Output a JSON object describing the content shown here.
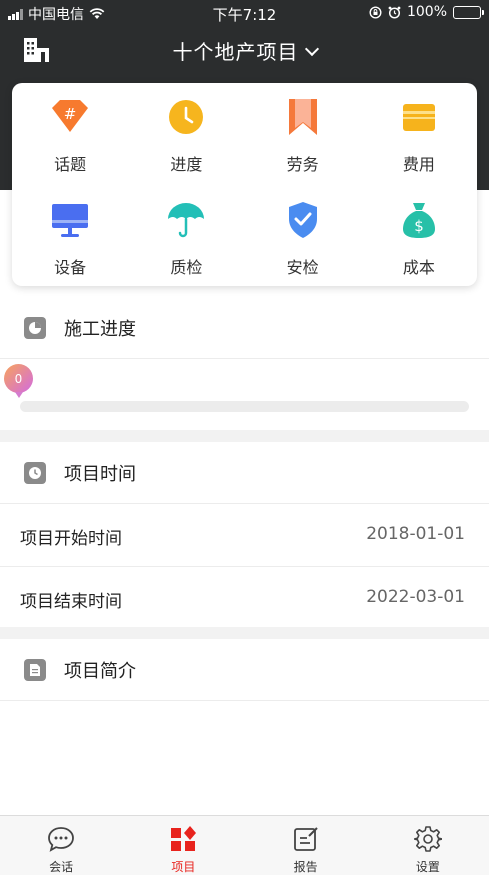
{
  "status_bar": {
    "carrier": "中国电信",
    "time": "下午7:12",
    "battery": "100%",
    "battery_level": 1.0
  },
  "nav": {
    "title": "十个地产项目",
    "left_icon": "building-icon",
    "title_icon": "chevron-down-icon"
  },
  "menu": {
    "items": [
      {
        "label": "话题",
        "icon": "hashtag-diamond-icon",
        "color": "#f77a2e"
      },
      {
        "label": "进度",
        "icon": "clock-icon",
        "color": "#f6b51e"
      },
      {
        "label": "劳务",
        "icon": "bookmark-icon",
        "color": "#f5793b"
      },
      {
        "label": "费用",
        "icon": "wallet-icon",
        "color": "#f6b31c"
      },
      {
        "label": "设备",
        "icon": "monitor-icon",
        "color": "#4a6ef0"
      },
      {
        "label": "质检",
        "icon": "umbrella-icon",
        "color": "#23bfb7"
      },
      {
        "label": "安检",
        "icon": "shield-check-icon",
        "color": "#4a8cf0"
      },
      {
        "label": "成本",
        "icon": "money-bag-icon",
        "color": "#27c0a8"
      }
    ]
  },
  "progress_section": {
    "title": "施工进度",
    "icon": "pie-chart-icon",
    "value_label": "0",
    "value": 0
  },
  "time_section": {
    "title": "项目时间",
    "icon": "clock-icon",
    "start_label": "项目开始时间",
    "start_value": "2018-01-01",
    "end_label": "项目结束时间",
    "end_value": "2022-03-01"
  },
  "intro_section": {
    "title": "项目简介",
    "icon": "document-icon"
  },
  "tab_bar": {
    "active_color": "#e8231d",
    "tabs": [
      {
        "label": "会话",
        "icon": "chat-bubble-icon",
        "active": false
      },
      {
        "label": "项目",
        "icon": "project-grid-icon",
        "active": true
      },
      {
        "label": "报告",
        "icon": "report-edit-icon",
        "active": false
      },
      {
        "label": "设置",
        "icon": "gear-icon",
        "active": false
      }
    ]
  }
}
